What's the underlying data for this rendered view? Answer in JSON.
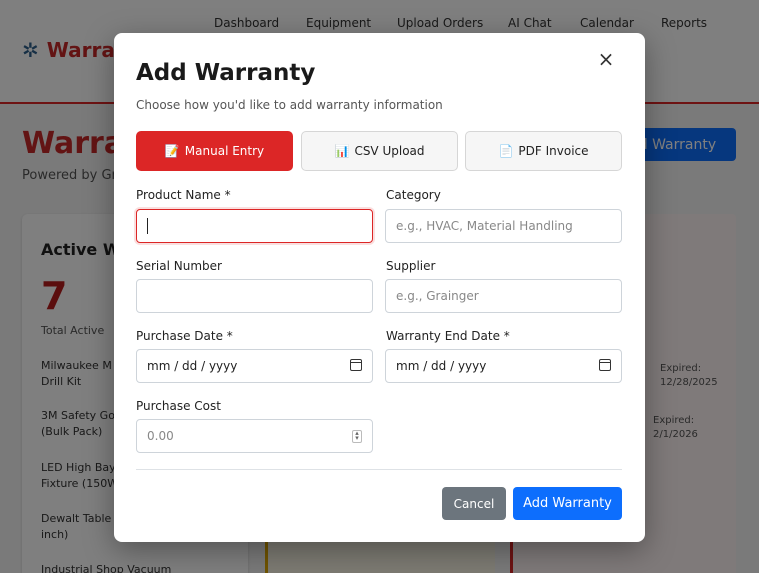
{
  "background": {
    "nav": [
      "Dashboard",
      "Equipment",
      "Upload Orders",
      "AI Chat",
      "Calendar",
      "Reports"
    ],
    "brand": "Warran",
    "page_title": "Warran",
    "page_subtitle": "Powered by Gra",
    "add_button": "dd Warranty",
    "active_card": {
      "title": "Active W",
      "count": "7",
      "count_label": "Total Active",
      "items": [
        "Milwaukee M\nDrill Kit",
        "3M Safety Go\n(Bulk Pack)",
        "LED High Bay\nFixture (150W",
        "Dewalt Table S\ninch)",
        "Industrial Shop Vacuum"
      ]
    },
    "expired": [
      {
        "label": "Expired:",
        "date": "12/28/2025"
      },
      {
        "label": "Expired:",
        "date": "2/1/2026"
      }
    ]
  },
  "modal": {
    "close_glyph": "×",
    "title": "Add Warranty",
    "subtitle": "Choose how you'd like to add warranty information",
    "tabs": [
      {
        "icon": "📝",
        "label": "Manual Entry"
      },
      {
        "icon": "📊",
        "label": "CSV Upload"
      },
      {
        "icon": "📄",
        "label": "PDF Invoice"
      }
    ],
    "fields": {
      "product_name": {
        "label": "Product Name *",
        "value": ""
      },
      "category": {
        "label": "Category",
        "placeholder": "e.g., HVAC, Material Handling"
      },
      "serial_number": {
        "label": "Serial Number",
        "value": ""
      },
      "supplier": {
        "label": "Supplier",
        "placeholder": "e.g., Grainger"
      },
      "purchase_date": {
        "label": "Purchase Date *",
        "value": "mm / dd / yyyy"
      },
      "warranty_end_date": {
        "label": "Warranty End Date *",
        "value": "mm / dd / yyyy"
      },
      "purchase_cost": {
        "label": "Purchase Cost",
        "placeholder": "0.00"
      }
    },
    "cancel_label": "Cancel",
    "submit_label": "Add Warranty"
  },
  "colors": {
    "accent_red": "#dc2626",
    "primary_blue": "#0d6efd",
    "secondary_gray": "#6c757d"
  }
}
